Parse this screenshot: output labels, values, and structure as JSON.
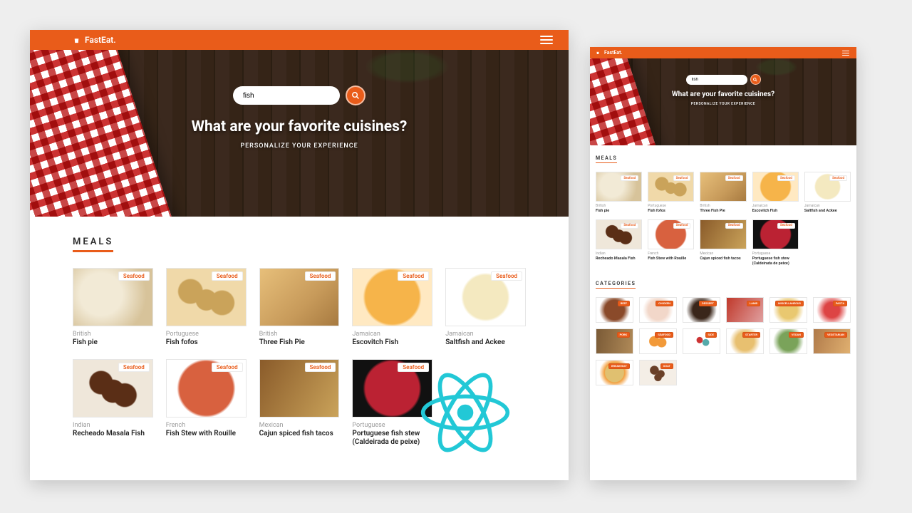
{
  "brand": "FastEat.",
  "hero": {
    "search_value": "fish",
    "headline": "What are your favorite cuisines?",
    "subline": "PERSONALIZE YOUR EXPERIENCE"
  },
  "sections": {
    "meals_title": "MEALS",
    "categories_title": "CATEGORIES"
  },
  "meals": [
    {
      "badge": "Seafood",
      "cuisine": "British",
      "name": "Fish pie",
      "fill": "f1"
    },
    {
      "badge": "Seafood",
      "cuisine": "Portuguese",
      "name": "Fish fofos",
      "fill": "f2"
    },
    {
      "badge": "Seafood",
      "cuisine": "British",
      "name": "Three Fish Pie",
      "fill": "f3"
    },
    {
      "badge": "Seafood",
      "cuisine": "Jamaican",
      "name": "Escovitch Fish",
      "fill": "f4"
    },
    {
      "badge": "Seafood",
      "cuisine": "Jamaican",
      "name": "Saltfish and Ackee",
      "fill": "f5"
    },
    {
      "badge": "Seafood",
      "cuisine": "Indian",
      "name": "Recheado Masala Fish",
      "fill": "f6"
    },
    {
      "badge": "Seafood",
      "cuisine": "French",
      "name": "Fish Stew with Rouille",
      "fill": "f7"
    },
    {
      "badge": "Seafood",
      "cuisine": "Mexican",
      "name": "Cajun spiced fish tacos",
      "fill": "f8"
    },
    {
      "badge": "Seafood",
      "cuisine": "Portuguese",
      "name": "Portuguese fish stew (Caldeirada de peixe)",
      "fill": "f9"
    }
  ],
  "categories": [
    {
      "label": "BEEF",
      "fill": "c1"
    },
    {
      "label": "CHICKEN",
      "fill": "c2"
    },
    {
      "label": "DESSERT",
      "fill": "c3"
    },
    {
      "label": "LAMB",
      "fill": "c4"
    },
    {
      "label": "MISCELLANEOUS",
      "fill": "c5"
    },
    {
      "label": "PASTA",
      "fill": "c6"
    },
    {
      "label": "PORK",
      "fill": "c7"
    },
    {
      "label": "SEAFOOD",
      "fill": "c8"
    },
    {
      "label": "SIDE",
      "fill": "c9"
    },
    {
      "label": "STARTER",
      "fill": "c10"
    },
    {
      "label": "VEGAN",
      "fill": "c11"
    },
    {
      "label": "VEGETARIAN",
      "fill": "c12"
    },
    {
      "label": "BREAKFAST",
      "fill": "c13"
    },
    {
      "label": "GOAT",
      "fill": "c14"
    }
  ]
}
